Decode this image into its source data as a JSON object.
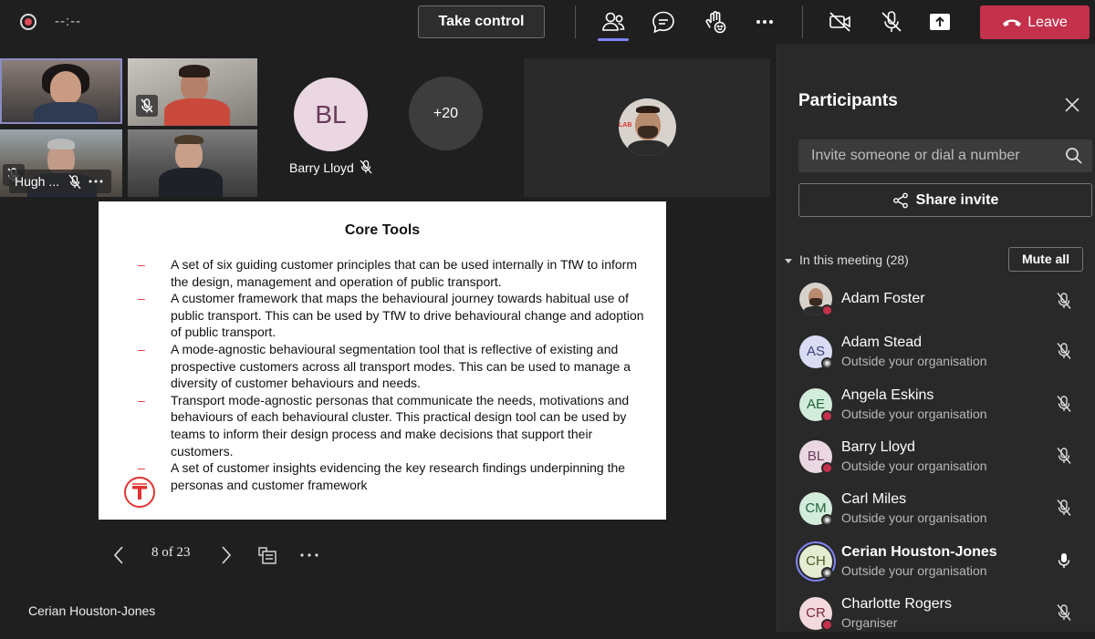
{
  "topbar": {
    "timer": "--:--",
    "take_control_label": "Take control",
    "leave_label": "Leave",
    "icons": [
      "record-icon",
      "people-icon",
      "chat-icon",
      "raise-hand-icon",
      "more-icon",
      "camera-off-icon",
      "mic-off-icon",
      "share-tray-icon",
      "phone-icon"
    ]
  },
  "stage": {
    "video_tiles": [
      {
        "name_tag": "Hugh ..."
      }
    ],
    "barry": {
      "initials": "BL",
      "name": "Barry Lloyd"
    },
    "overflow_count": "+20",
    "presenter_name": "Cerian Houston-Jones"
  },
  "slide": {
    "title": "Core Tools",
    "bullets": [
      "A set of six guiding customer principles that can be used internally in TfW to inform the design, management and operation of public transport.",
      "A customer framework that maps the behavioural journey towards habitual use of public transport. This can be used by TfW to drive behavioural change and adoption of public transport.",
      "A mode-agnostic behavioural segmentation tool that is reflective of existing and prospective customers across all transport modes. This can be used to manage a diversity of customer behaviours and needs.",
      "Transport mode-agnostic personas that communicate the needs, motivations and behaviours of each behavioural cluster. This practical design tool can be used by teams to inform their design process and make decisions that support their customers.",
      "A set of customer insights evidencing the key research findings underpinning the personas and customer framework"
    ],
    "bullet_marker": "–",
    "page_indicator": "8 of 23"
  },
  "panel": {
    "title": "Participants",
    "invite_placeholder": "Invite someone or dial a number",
    "share_invite_label": "Share invite",
    "in_meeting_label": "In this meeting (28)",
    "mute_all_label": "Mute all",
    "participants": [
      {
        "name": "Adam Foster",
        "subtitle": "",
        "initials": "",
        "avatar_bg": "#d7d2cc",
        "status": "busy",
        "mic": "muted"
      },
      {
        "name": "Adam Stead",
        "subtitle": "Outside your organisation",
        "initials": "AS",
        "avatar_bg": "#d9dcf3",
        "avatar_fg": "#3a3f7a",
        "status": "away",
        "mic": "muted"
      },
      {
        "name": "Angela Eskins",
        "subtitle": "Outside your organisation",
        "initials": "AE",
        "avatar_bg": "#d2ecdc",
        "avatar_fg": "#22633a",
        "status": "busy",
        "mic": "muted"
      },
      {
        "name": "Barry Lloyd",
        "subtitle": "Outside your organisation",
        "initials": "BL",
        "avatar_bg": "#ead7e2",
        "avatar_fg": "#6b3b5a",
        "status": "busy",
        "mic": "muted"
      },
      {
        "name": "Carl Miles",
        "subtitle": "Outside your organisation",
        "initials": "CM",
        "avatar_bg": "#d2ecdc",
        "avatar_fg": "#22633a",
        "status": "away",
        "mic": "muted"
      },
      {
        "name": "Cerian Houston-Jones",
        "subtitle": "Outside your organisation",
        "initials": "CH",
        "avatar_bg": "#e5ecd2",
        "avatar_fg": "#4b5a22",
        "status": "away",
        "mic": "on"
      },
      {
        "name": "Charlotte Rogers",
        "subtitle": "Organiser",
        "initials": "CR",
        "avatar_bg": "#f3d9de",
        "avatar_fg": "#7a2a3a",
        "status": "busy",
        "mic": "muted"
      }
    ]
  },
  "colors": {
    "accent": "#7f85f5",
    "leave": "#c4314b",
    "bullet": "#e2322f",
    "background": "#1f1f1f",
    "panel": "#292929"
  }
}
